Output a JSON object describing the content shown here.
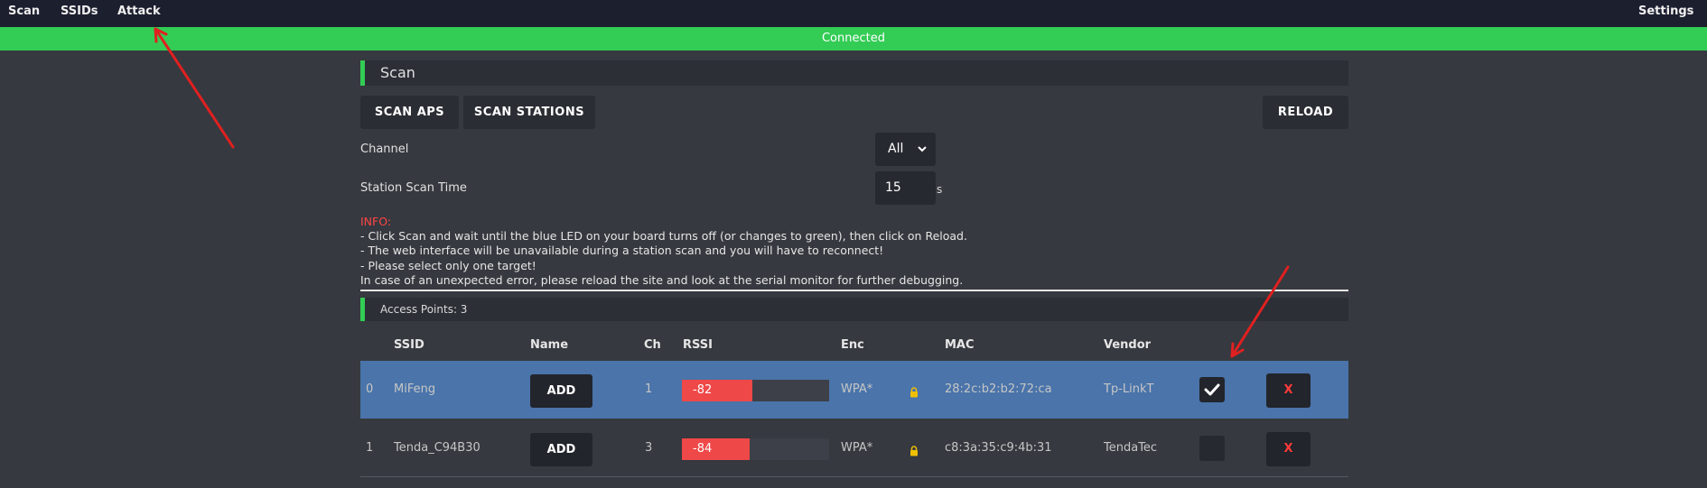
{
  "nav": {
    "scan": "Scan",
    "ssids": "SSIDs",
    "attack": "Attack",
    "settings": "Settings"
  },
  "status": "Connected",
  "scan_panel": {
    "title": "Scan",
    "scan_aps": "SCAN APS",
    "scan_stations": "SCAN STATIONS",
    "reload": "RELOAD",
    "channel_label": "Channel",
    "channel_value": "All",
    "station_time_label": "Station Scan Time",
    "station_time_value": "15",
    "station_time_unit": "s"
  },
  "info": {
    "heading": "INFO:",
    "lines": [
      "- Click Scan and wait until the blue LED on your board turns off (or changes to green), then click on Reload.",
      "- The web interface will be unavailable during a station scan and you will have to reconnect!",
      "- Please select only one target!",
      "In case of an unexpected error, please reload the site and look at the serial monitor for further debugging."
    ]
  },
  "access_points": {
    "title": "Access Points: 3",
    "headers": {
      "ssid": "SSID",
      "name": "Name",
      "ch": "Ch",
      "rssi": "RSSI",
      "enc": "Enc",
      "mac": "MAC",
      "vendor": "Vendor"
    },
    "add_label": "ADD",
    "delete_label": "X",
    "rows": [
      {
        "index": "0",
        "ssid": "MiFeng",
        "ch": "1",
        "rssi": "-82",
        "rssi_level": 0.48,
        "enc": "WPA*",
        "mac": "28:2c:b2:b2:72:ca",
        "vendor": "Tp-LinkT",
        "selected": true
      },
      {
        "index": "1",
        "ssid": "Tenda_C94B30",
        "ch": "3",
        "rssi": "-84",
        "rssi_level": 0.46,
        "enc": "WPA*",
        "mac": "c8:3a:35:c9:4b:31",
        "vendor": "TendaTec",
        "selected": false
      }
    ]
  },
  "colors": {
    "accent_green": "#33cc55",
    "selected_row": "#4a74aa",
    "rssi_bar": "#ef4848",
    "annotation_arrow": "#e02020"
  },
  "icons": {
    "lock": "lock-icon",
    "check": "check-icon",
    "chevron": "chevron-down-icon"
  }
}
